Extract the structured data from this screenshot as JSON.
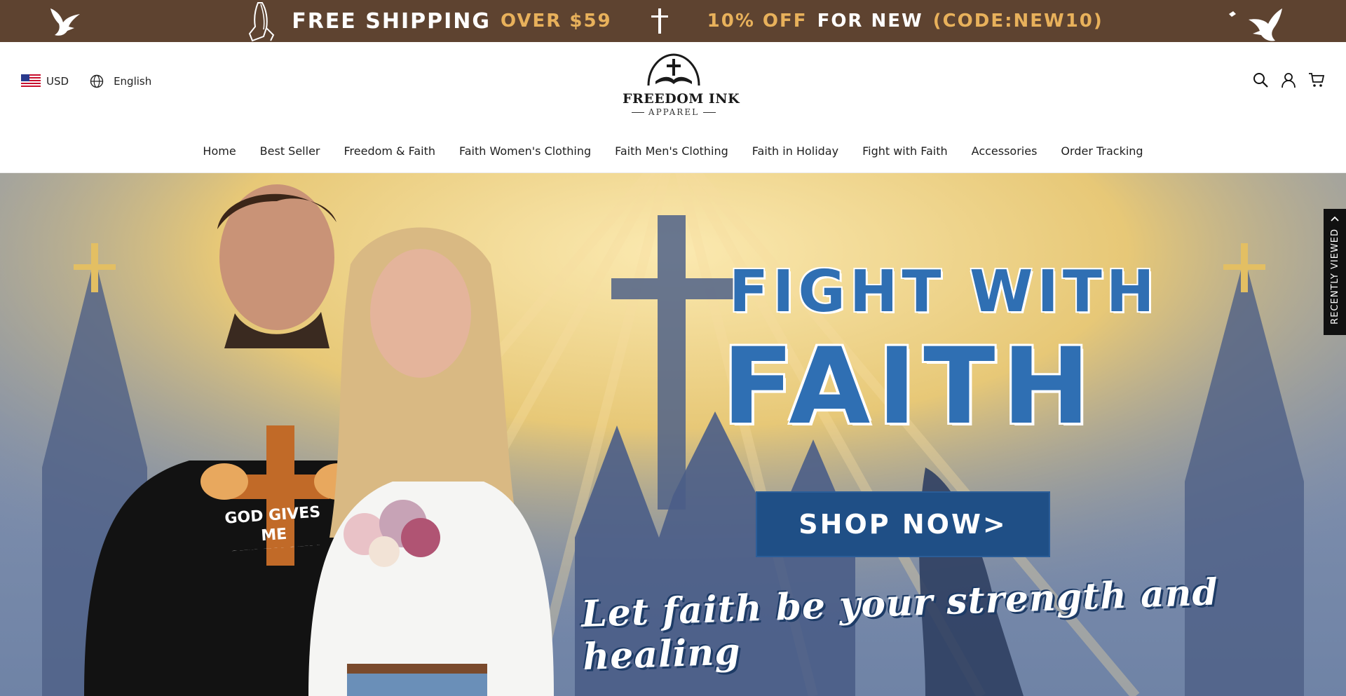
{
  "announcement": {
    "free_shipping": "FREE SHIPPING",
    "over_amount": "OVER $59",
    "discount": "10% OFF",
    "for_new": "FOR NEW",
    "code": "(CODE:NEW10)",
    "bg_color": "#5e4330",
    "accent_color": "#e8b15b"
  },
  "header": {
    "currency": "USD",
    "language": "English",
    "logo_title": "FREEDOM INK",
    "logo_subtitle": "APPAREL",
    "icons": [
      "search-icon",
      "account-icon",
      "cart-icon"
    ]
  },
  "nav": {
    "items": [
      "Home",
      "Best Seller",
      "Freedom & Faith",
      "Faith Women's Clothing",
      "Faith Men's Clothing",
      "Faith in Holiday",
      "Fight with Faith",
      "Accessories",
      "Order Tracking"
    ]
  },
  "hero": {
    "title_line1": "FIGHT WITH",
    "title_line2": "FAITH",
    "cta": "SHOP NOW>",
    "tagline": "Let faith be your strength and healing",
    "shirt_text": "GOD GIVES ME STRENGTH",
    "title_color": "#2f6fb3",
    "button_color": "#1f4f86"
  },
  "sidebar_tab": {
    "label": "RECENTLY VIEWED"
  }
}
